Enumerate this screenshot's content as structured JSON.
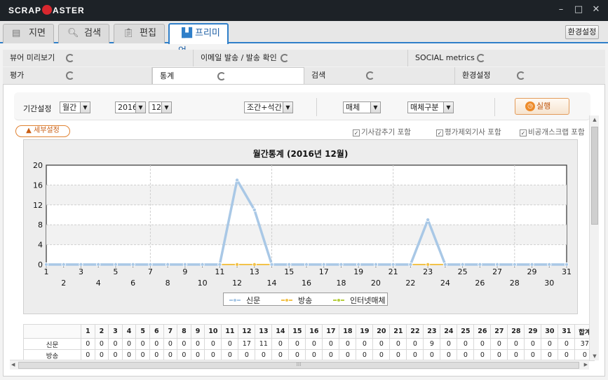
{
  "window": {
    "logo_left": "SCRAP",
    "logo_right": "ASTER"
  },
  "main_tabs": [
    {
      "label": "지면",
      "icon": "newspaper-icon"
    },
    {
      "label": "검색",
      "icon": "search-icon"
    },
    {
      "label": "편집",
      "icon": "clipboard-icon"
    },
    {
      "label": "프리미엄",
      "icon": "bar-chart-icon"
    }
  ],
  "env_button": "환경설정",
  "subtabs_row1": [
    {
      "label": "뷰어 미리보기"
    },
    {
      "label": "이메일 발송 / 발송 확인"
    },
    {
      "label": "SOCIAL metrics"
    }
  ],
  "subtabs_row2": [
    {
      "label": "평가"
    },
    {
      "label": "통계"
    },
    {
      "label": "검색"
    },
    {
      "label": "환경설정"
    }
  ],
  "filters": {
    "period_label": "기간설정",
    "period": "월간",
    "year": "2016",
    "month": "12",
    "edition": "조간+석간",
    "media": "매체",
    "media_type": "매체구분",
    "run": "실행"
  },
  "detail_button": "▲ 세부설정",
  "checkboxes": [
    {
      "label": "기사감추기 포함",
      "checked": true
    },
    {
      "label": "평가제외기사 포함",
      "checked": true
    },
    {
      "label": "비공개스크랩 포함",
      "checked": true
    }
  ],
  "chart_data": {
    "type": "line",
    "title": "월간통계 (2016년 12월)",
    "x": [
      1,
      2,
      3,
      4,
      5,
      6,
      7,
      8,
      9,
      10,
      11,
      12,
      13,
      14,
      15,
      16,
      17,
      18,
      19,
      20,
      21,
      22,
      23,
      24,
      25,
      26,
      27,
      28,
      29,
      30,
      31
    ],
    "ylim": [
      0,
      20
    ],
    "yticks": [
      0,
      4,
      8,
      12,
      16,
      20
    ],
    "grid": true,
    "legend_position": "bottom",
    "series": [
      {
        "name": "신문",
        "color": "#a9c8e6",
        "values": [
          0,
          0,
          0,
          0,
          0,
          0,
          0,
          0,
          0,
          0,
          0,
          17,
          11,
          0,
          0,
          0,
          0,
          0,
          0,
          0,
          0,
          0,
          9,
          0,
          0,
          0,
          0,
          0,
          0,
          0,
          0
        ]
      },
      {
        "name": "방송",
        "color": "#f2c24a",
        "values": [
          0,
          0,
          0,
          0,
          0,
          0,
          0,
          0,
          0,
          0,
          0,
          0,
          0,
          0,
          0,
          0,
          0,
          0,
          0,
          0,
          0,
          0,
          0,
          0,
          0,
          0,
          0,
          0,
          0,
          0,
          0
        ]
      },
      {
        "name": "인터넷매체",
        "color": "#b6cf3e",
        "values": [
          0,
          0,
          0,
          0,
          0,
          0,
          0,
          0,
          0,
          0,
          0,
          0,
          0,
          0,
          0,
          0,
          0,
          0,
          0,
          0,
          0,
          0,
          0,
          0,
          0,
          0,
          0,
          0,
          0,
          0,
          0
        ]
      }
    ]
  },
  "table": {
    "total_label": "합계",
    "rows": [
      {
        "label": "신문",
        "values": [
          0,
          0,
          0,
          0,
          0,
          0,
          0,
          0,
          0,
          0,
          0,
          17,
          11,
          0,
          0,
          0,
          0,
          0,
          0,
          0,
          0,
          0,
          9,
          0,
          0,
          0,
          0,
          0,
          0,
          0,
          0
        ],
        "total": 37
      },
      {
        "label": "방송",
        "values": [
          0,
          0,
          0,
          0,
          0,
          0,
          0,
          0,
          0,
          0,
          0,
          0,
          0,
          0,
          0,
          0,
          0,
          0,
          0,
          0,
          0,
          0,
          0,
          0,
          0,
          0,
          0,
          0,
          0,
          0,
          0
        ],
        "total": 0
      }
    ]
  }
}
